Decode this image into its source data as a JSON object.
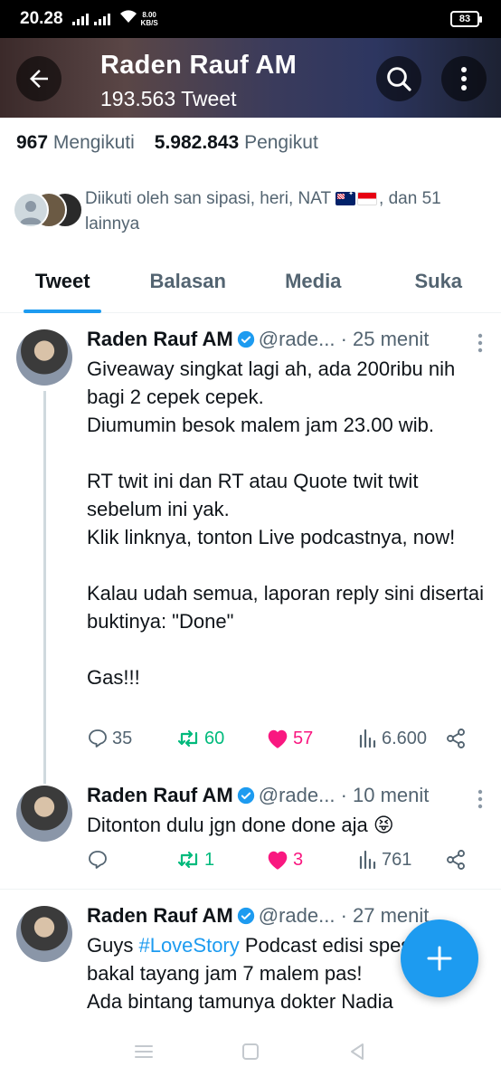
{
  "status_bar": {
    "time": "20.28",
    "net_speed_value": "8.00",
    "net_speed_unit": "KB/S",
    "battery": "83"
  },
  "header": {
    "title": "Raden Rauf AM",
    "subtitle": "193.563 Tweet",
    "icons": [
      "arrow-left-icon",
      "search-icon",
      "more-vertical-icon"
    ]
  },
  "profile": {
    "following_count": "967",
    "following_label": "Mengikuti",
    "followers_count": "5.982.843",
    "followers_label": "Pengikut",
    "followed_by_prefix": "Diikuti oleh san sipasi, heri, NAT",
    "followed_by_suffix": ", dan 51 lainnya"
  },
  "tabs": [
    {
      "label": "Tweet",
      "active": true
    },
    {
      "label": "Balasan",
      "active": false
    },
    {
      "label": "Media",
      "active": false
    },
    {
      "label": "Suka",
      "active": false
    }
  ],
  "tweets": [
    {
      "name": "Raden Rauf AM",
      "handle": "@rade...",
      "time": "· 25 menit",
      "text": "Giveaway singkat lagi ah, ada 200ribu nih bagi 2 cepek cepek.\nDiumumin besok malem jam 23.00 wib.\n\nRT twit ini dan RT atau Quote twit twit sebelum ini yak.\nKlik linknya, tonton Live podcastnya, now!\n\nKalau udah semua, laporan reply sini disertai buktinya: \"Done\"\n\nGas!!!",
      "replies": "35",
      "retweets": "60",
      "likes": "57",
      "views": "6.600"
    },
    {
      "name": "Raden Rauf AM",
      "handle": "@rade...",
      "time": "· 10 menit",
      "text": "Ditonton dulu jgn done done aja 😝",
      "replies": "",
      "retweets": "1",
      "likes": "3",
      "views": "761"
    },
    {
      "name": "Raden Rauf AM",
      "handle": "@rade...",
      "time": "· 27 menit",
      "text_before_hashtag": "Guys ",
      "hashtag": "#LoveStory",
      "text_after_hashtag": " Podcast edisi spesial\nbakal tayang jam 7 malem pas!\nAda bintang tamunya dokter Nadia"
    }
  ],
  "colors": {
    "accent": "#1d9bf0",
    "retweet": "#00ba7c",
    "like": "#f91880",
    "muted": "#536471"
  }
}
